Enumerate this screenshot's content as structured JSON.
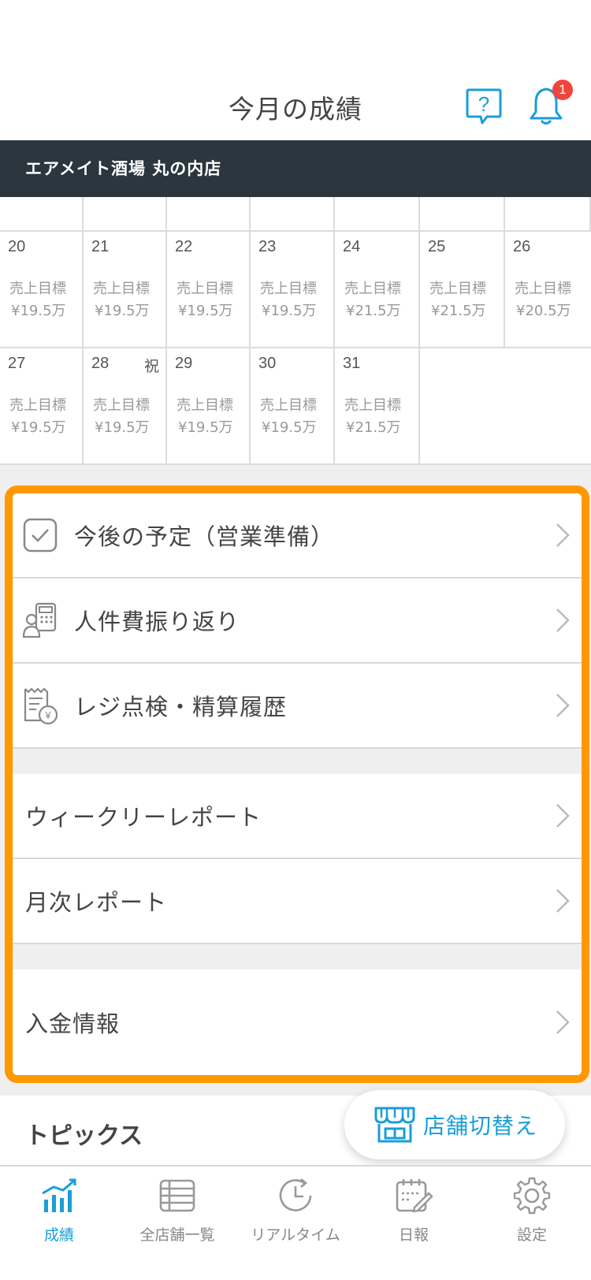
{
  "header": {
    "title": "今月の成績",
    "notification_count": "1"
  },
  "store": {
    "name": "エアメイト酒場 丸の内店"
  },
  "calendar": {
    "rows": [
      [
        {
          "day": "20",
          "label": "売上目標",
          "value": "¥19.5万"
        },
        {
          "day": "21",
          "label": "売上目標",
          "value": "¥19.5万"
        },
        {
          "day": "22",
          "label": "売上目標",
          "value": "¥19.5万"
        },
        {
          "day": "23",
          "label": "売上目標",
          "value": "¥19.5万"
        },
        {
          "day": "24",
          "label": "売上目標",
          "value": "¥21.5万"
        },
        {
          "day": "25",
          "label": "売上目標",
          "value": "¥21.5万"
        },
        {
          "day": "26",
          "label": "売上目標",
          "value": "¥20.5万"
        }
      ],
      [
        {
          "day": "27",
          "label": "売上目標",
          "value": "¥19.5万"
        },
        {
          "day": "28",
          "holiday": "祝",
          "label": "売上目標",
          "value": "¥19.5万"
        },
        {
          "day": "29",
          "label": "売上目標",
          "value": "¥19.5万"
        },
        {
          "day": "30",
          "label": "売上目標",
          "value": "¥19.5万"
        },
        {
          "day": "31",
          "label": "売上目標",
          "value": "¥21.5万"
        }
      ]
    ]
  },
  "menu": {
    "schedule": "今後の予定（営業準備）",
    "labor": "人件費振り返り",
    "register": "レジ点検・精算履歴",
    "weekly": "ウィークリーレポート",
    "monthly": "月次レポート",
    "deposit": "入金情報"
  },
  "topics": {
    "title": "トピックス"
  },
  "switch_store": {
    "label": "店舗切替え"
  },
  "tabs": {
    "performance": "成績",
    "all_stores": "全店舗一覧",
    "realtime": "リアルタイム",
    "daily": "日報",
    "settings": "設定"
  },
  "colors": {
    "accent": "#1a9ed8",
    "highlight": "#ff9800",
    "store_bar": "#2b363e",
    "badge": "#f0453a"
  }
}
